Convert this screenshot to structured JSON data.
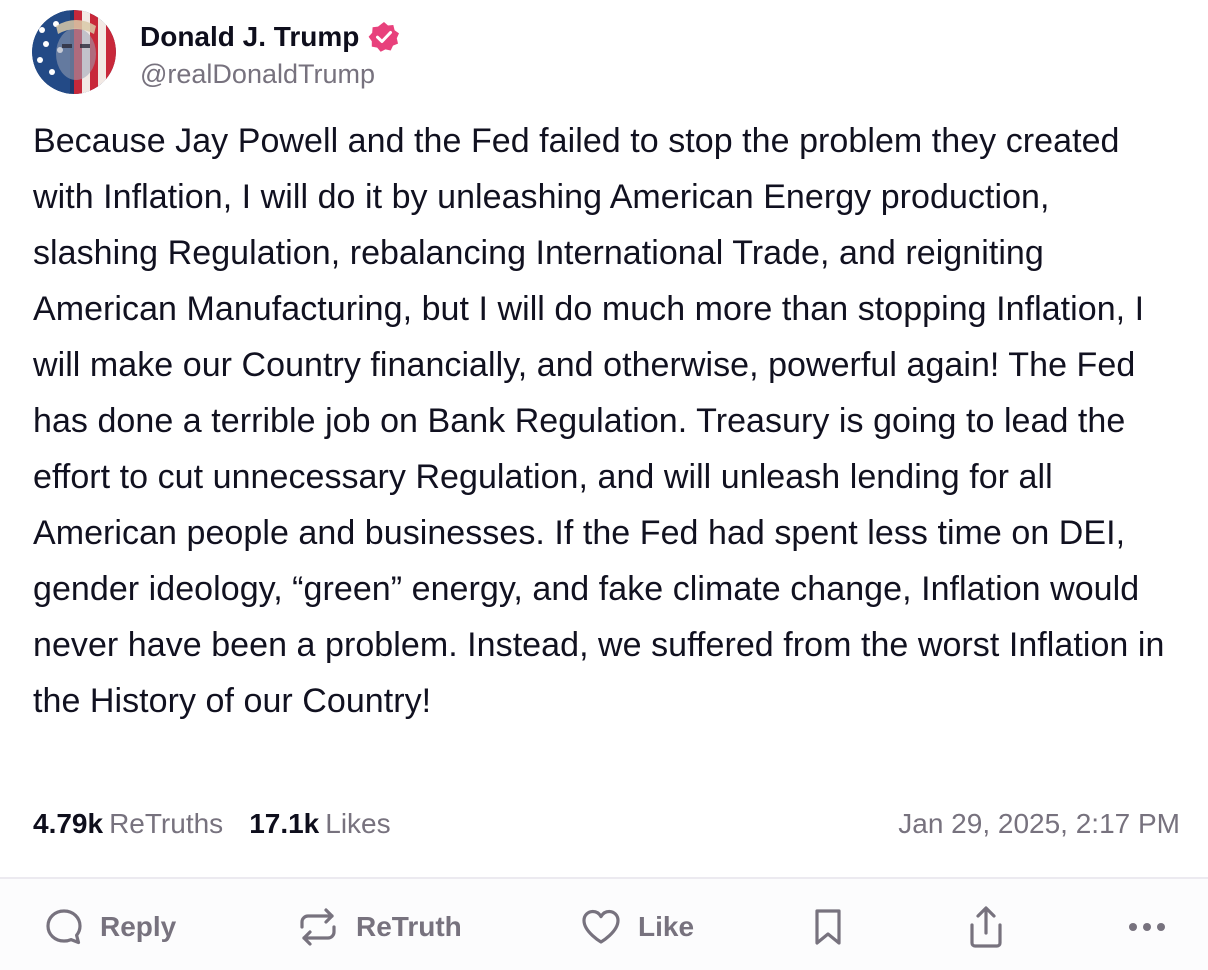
{
  "post": {
    "author": {
      "display_name": "Donald J. Trump",
      "handle": "@realDonaldTrump",
      "verified": true,
      "verified_color": "#e8417c"
    },
    "body": "Because Jay Powell and the Fed failed to stop the problem they created with Inflation, I will do it by unleashing American Energy production, slashing Regulation, rebalancing International Trade, and reigniting American Manufacturing, but I will do much more than stopping Inflation, I will make our Country financially, and otherwise, powerful again! The Fed has done a terrible job on Bank Regulation. Treasury is going to lead the effort to cut unnecessary Regulation, and will unleash lending for all American people and businesses. If the Fed had spent less time on DEI, gender ideology, “green” energy, and fake climate change, Inflation would never have been a problem. Instead, we suffered from the worst Inflation in the History of our Country!",
    "stats": {
      "retruths_count": "4.79k",
      "retruths_label": "ReTruths",
      "likes_count": "17.1k",
      "likes_label": "Likes"
    },
    "timestamp": "Jan 29, 2025, 2:17 PM"
  },
  "actions": {
    "reply": {
      "label": "Reply",
      "icon": "reply-bubble-icon"
    },
    "retruth": {
      "label": "ReTruth",
      "icon": "retruth-arrows-icon"
    },
    "like": {
      "label": "Like",
      "icon": "heart-icon"
    },
    "bookmark": {
      "icon": "bookmark-icon"
    },
    "share": {
      "icon": "share-icon"
    },
    "more": {
      "icon": "more-dots-icon"
    }
  },
  "colors": {
    "text": "#111120",
    "muted": "#77727e",
    "divider": "#eceaf0"
  }
}
